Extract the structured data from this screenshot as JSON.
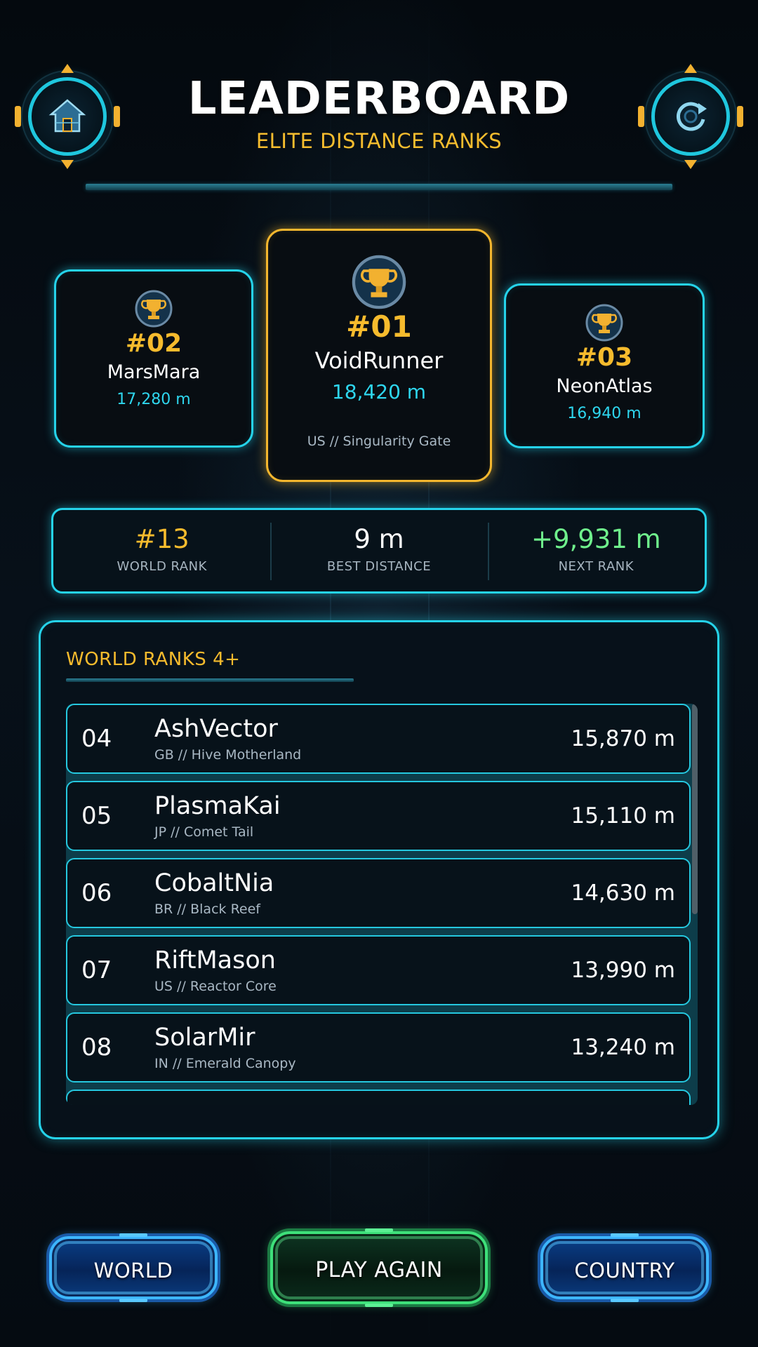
{
  "header": {
    "title": "LEADERBOARD",
    "subtitle": "ELITE DISTANCE RANKS",
    "left_icon": "home-icon",
    "right_icon": "refresh-icon"
  },
  "podium": {
    "first": {
      "rank": "#01",
      "name": "VoidRunner",
      "distance": "18,420 m",
      "origin": "US  //  Singularity Gate",
      "icon": "trophy-icon"
    },
    "second": {
      "rank": "#02",
      "name": "MarsMara",
      "distance": "17,280 m",
      "icon": "trophy-icon"
    },
    "third": {
      "rank": "#03",
      "name": "NeonAtlas",
      "distance": "16,940 m",
      "icon": "trophy-icon"
    }
  },
  "stats": {
    "world_rank": {
      "value": "#13",
      "label": "WORLD RANK"
    },
    "best_distance": {
      "value": "9 m",
      "label": "BEST DISTANCE"
    },
    "next_rank": {
      "value": "+9,931 m",
      "label": "NEXT RANK"
    }
  },
  "ranks_panel": {
    "title": "WORLD RANKS 4+",
    "rows": [
      {
        "rank": "04",
        "name": "AshVector",
        "origin": "GB  //  Hive Motherland",
        "distance": "15,870 m"
      },
      {
        "rank": "05",
        "name": "PlasmaKai",
        "origin": "JP  //  Comet Tail",
        "distance": "15,110 m"
      },
      {
        "rank": "06",
        "name": "CobaltNia",
        "origin": "BR  //  Black Reef",
        "distance": "14,630 m"
      },
      {
        "rank": "07",
        "name": "RiftMason",
        "origin": "US  //  Reactor Core",
        "distance": "13,990 m"
      },
      {
        "rank": "08",
        "name": "SolarMir",
        "origin": "IN  //  Emerald Canopy",
        "distance": "13,240 m"
      }
    ]
  },
  "buttons": {
    "world": "WORLD",
    "play_again": "PLAY AGAIN",
    "country": "COUNTRY"
  },
  "colors": {
    "accent_cyan": "#25d3ea",
    "accent_gold": "#f6bb2d",
    "positive_green": "#6ff08c",
    "background": "#050b11"
  }
}
